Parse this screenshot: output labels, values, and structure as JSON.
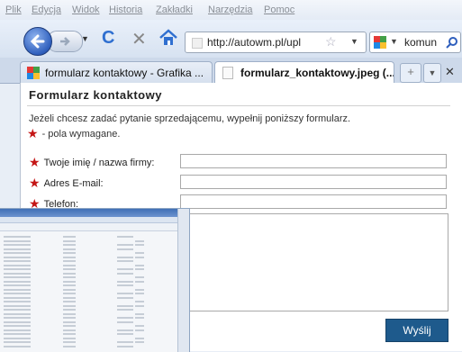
{
  "menu": [
    "Plik",
    "Edycja",
    "Widok",
    "Historia",
    "Zakładki",
    "Narzędzia",
    "Pomoc"
  ],
  "address": {
    "url": "http://autowm.pl/upl"
  },
  "search": {
    "text": "komun"
  },
  "tabs": [
    {
      "label": "formularz kontaktowy - Grafika ...",
      "active": false
    },
    {
      "label": "formularz_kontaktowy.jpeg (...",
      "active": true
    }
  ],
  "form": {
    "title": "Formularz kontaktowy",
    "intro": "Jeżeli chcesz zadać pytanie sprzedającemu, wypełnij poniższy formularz.",
    "required_note": "- pola wymagane.",
    "fields": [
      {
        "label": "Twoje imię / nazwa firmy:",
        "value": ""
      },
      {
        "label": "Adres E-mail:",
        "value": ""
      },
      {
        "label": "Telefon:",
        "value": ""
      }
    ],
    "submit_label": "Wyślij"
  },
  "colors": {
    "accent": "#1e5a8c",
    "required": "#c41515",
    "nav_blue": "#2f5fbd"
  }
}
